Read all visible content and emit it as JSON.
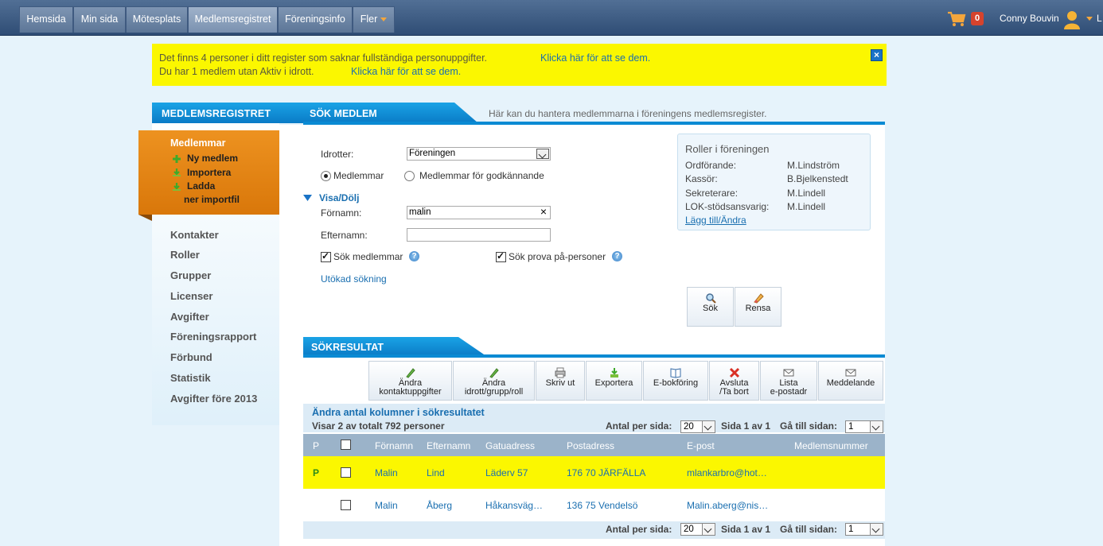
{
  "nav": {
    "tabs": [
      {
        "label": "Hemsida"
      },
      {
        "label": "Min sida"
      },
      {
        "label": "Mötesplats"
      },
      {
        "label": "Medlemsregistret"
      },
      {
        "label": "Föreningsinfo"
      },
      {
        "label": "Fler"
      }
    ],
    "active_tab": "Medlemsregistret",
    "cart_count": "0",
    "user_name": "Conny Bouvin",
    "right_cut_text": "L"
  },
  "alert": {
    "line1": "Det finns 4 personer i ditt register som saknar fullständiga personuppgifter.",
    "link1": "Klicka här för att se dem.",
    "line2": "Du har 1 medlem utan Aktiv i idrott.",
    "link2": "Klicka här för att se dem.",
    "close_icon": "close-icon"
  },
  "sidebar": {
    "header": "MEDLEMSREGISTRET",
    "section_title": "Medlemmar",
    "sub_items": [
      {
        "label": "Ny medlem",
        "icon": "plus-icon"
      },
      {
        "label": "Importera",
        "icon": "import-icon"
      },
      {
        "label": "Ladda",
        "icon": "download-icon"
      },
      {
        "label": "ner importfil"
      }
    ],
    "links": [
      "Kontakter",
      "Roller",
      "Grupper",
      "Licenser",
      "Avgifter",
      "Föreningsrapport",
      "Förbund",
      "Statistik",
      "Avgifter före 2013"
    ]
  },
  "main": {
    "header": "SÖK MEDLEM",
    "description": "Här kan du hantera medlemmarna i föreningens medlemsregister.",
    "idrotter_label": "Idrotter:",
    "idrotter_value": "Föreningen",
    "radio_members": "Medlemmar",
    "radio_approval": "Medlemmar för godkännande",
    "toggle_label": "Visa/Dölj",
    "fornamn_label": "Förnamn:",
    "fornamn_value": "malin",
    "clear_x": "×",
    "efternamn_label": "Efternamn:",
    "efternamn_value": "",
    "check_members": "Sök medlemmar",
    "check_trial": "Sök prova på-personer",
    "help_glyph": "?",
    "extended_search": "Utökad sökning",
    "search_button": "Sök",
    "clear_button": "Rensa"
  },
  "roles": {
    "title": "Roller i föreningen",
    "items": [
      {
        "role": "Ordförande:",
        "name": "M.Lindström"
      },
      {
        "role": "Kassör:",
        "name": "B.Bjelkenstedt"
      },
      {
        "role": "Sekreterare:",
        "name": "M.Lindell"
      },
      {
        "role": "LOK-stödsansvarig:",
        "name": "M.Lindell"
      }
    ],
    "edit_link": "Lägg till/Ändra"
  },
  "results": {
    "header": "SÖKRESULTAT",
    "toolbar": [
      {
        "line1": "Ändra",
        "line2": "kontaktuppgifter",
        "icon": "pencil-icon"
      },
      {
        "line1": "Ändra",
        "line2": "idrott/grupp/roll",
        "icon": "pencil-icon"
      },
      {
        "line1": "Skriv ut",
        "line2": "",
        "icon": "print-icon"
      },
      {
        "line1": "Exportera",
        "line2": "",
        "icon": "export-icon"
      },
      {
        "line1": "E-bokföring",
        "line2": "",
        "icon": "book-icon"
      },
      {
        "line1": "Avsluta",
        "line2": "/Ta bort",
        "icon": "delete-icon"
      },
      {
        "line1": "Lista",
        "line2": "e-postadr",
        "icon": "mail-icon"
      },
      {
        "line1": "Meddelande",
        "line2": "",
        "icon": "mail-icon"
      }
    ],
    "change_columns": "Ändra antal kolumner i sökresultatet",
    "showing": "Visar 2 av totalt 792 personer",
    "per_page_label": "Antal per sida:",
    "per_page_value": "20",
    "page_info": "Sida 1 av 1",
    "goto_label": "Gå till sidan:",
    "goto_value": "1",
    "columns": [
      "P",
      "",
      "Förnamn",
      "Efternamn",
      "Gatuadress",
      "Postadress",
      "E-post",
      "Medlemsnummer"
    ],
    "rows": [
      {
        "p": "P",
        "fornamn": "Malin",
        "efternamn": "Lind",
        "gatuadress": "Läderv 57",
        "postadress": "176 70 JÄRFÄLLA",
        "epost": "mlankarbro@hot…",
        "medlemsnummer": "",
        "highlight": true
      },
      {
        "p": "",
        "fornamn": "Malin",
        "efternamn": "Åberg",
        "gatuadress": "Håkansväg…",
        "postadress": "136 75 Vendelsö",
        "epost": "Malin.aberg@nis…",
        "medlemsnummer": "",
        "highlight": false
      }
    ]
  },
  "colors": {
    "nav_bg": "#3b5a82",
    "accent_blue": "#0a8ad3",
    "alert_bg": "#fbf700",
    "orange": "#e5850f",
    "highlight_row": "#fbf700",
    "link": "#1a6fb0"
  }
}
